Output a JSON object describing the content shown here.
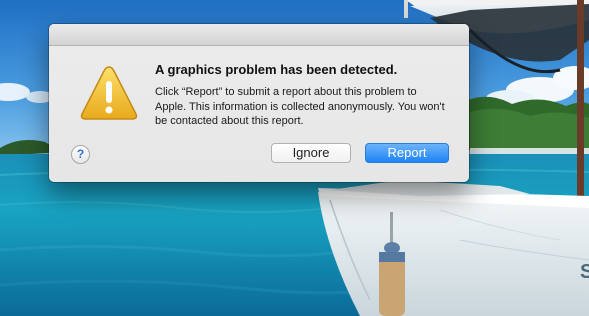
{
  "dialog": {
    "headline": "A graphics problem has been detected.",
    "message": "Click “Report” to submit a report about this problem to Apple. This information is collected anonymously. You won't be contacted about this report.",
    "help_label": "?",
    "buttons": {
      "ignore_label": "Ignore",
      "report_label": "Report"
    },
    "icon": "warning-triangle-icon"
  },
  "colors": {
    "default_button": "#1e84f6",
    "warning_icon": "#f2c12e"
  },
  "wallpaper": {
    "boat_lettering": "S"
  }
}
